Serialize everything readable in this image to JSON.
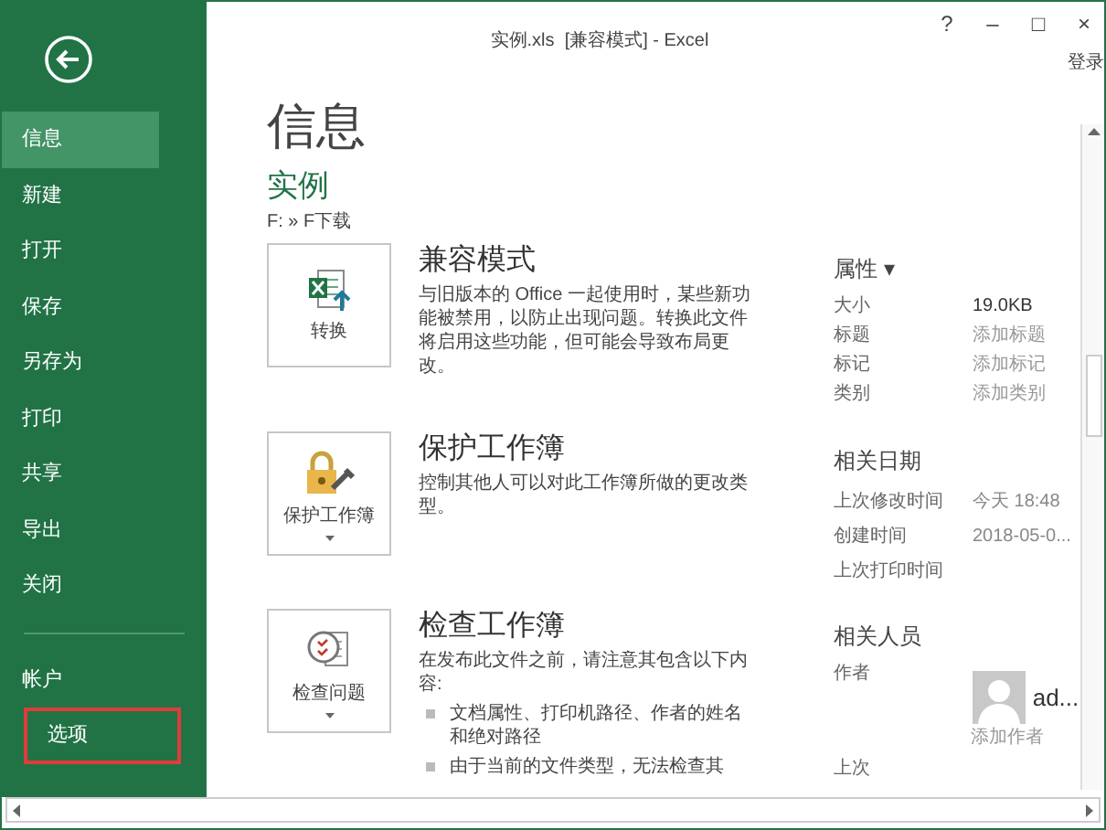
{
  "window": {
    "title": "实例.xls  [兼容模式] - Excel",
    "controls": [
      "?",
      "–",
      "□",
      "×"
    ],
    "sign_in": "登录"
  },
  "sidebar": {
    "items": [
      {
        "label": "信息",
        "selected": true,
        "highlighted": false
      },
      {
        "label": "新建",
        "selected": false,
        "highlighted": false
      },
      {
        "label": "打开",
        "selected": false,
        "highlighted": false
      },
      {
        "label": "保存",
        "selected": false,
        "highlighted": false
      },
      {
        "label": "另存为",
        "selected": false,
        "highlighted": false
      },
      {
        "label": "打印",
        "selected": false,
        "highlighted": false
      },
      {
        "label": "共享",
        "selected": false,
        "highlighted": false
      },
      {
        "label": "导出",
        "selected": false,
        "highlighted": false
      },
      {
        "label": "关闭",
        "selected": false,
        "highlighted": false
      }
    ],
    "bottom_items": [
      {
        "label": "帐户",
        "selected": false,
        "highlighted": false
      },
      {
        "label": "选项",
        "selected": false,
        "highlighted": true
      }
    ]
  },
  "page_title": "信息",
  "file": {
    "name": "实例",
    "path": "F: » F下载"
  },
  "sections": [
    {
      "kind": "convert",
      "button": "转换",
      "has_menu": false,
      "title": "兼容模式",
      "text": "与旧版本的 Office 一起使用时，某些新功能被禁用，以防止出现问题。转换此文件将启用这些功能，但可能会导致布局更改。"
    },
    {
      "kind": "protect",
      "button": "保护工作簿",
      "has_menu": true,
      "title": "保护工作簿",
      "text": "控制其他人可以对此工作簿所做的更改类型。"
    },
    {
      "kind": "inspect",
      "button": "检查问题",
      "has_menu": true,
      "title": "检查工作簿",
      "text": "在发布此文件之前，请注意其包含以下内容:",
      "bullets": [
        "文档属性、打印机路径、作者的姓名和绝对路径",
        "由于当前的文件类型，无法检查其"
      ]
    }
  ],
  "properties": {
    "title": "属性 ▾",
    "rows": [
      {
        "label": "大小",
        "value": "19.0KB",
        "placeholder": false
      },
      {
        "label": "标题",
        "value": "添加标题",
        "placeholder": true
      },
      {
        "label": "标记",
        "value": "添加标记",
        "placeholder": true
      },
      {
        "label": "类别",
        "value": "添加类别",
        "placeholder": true
      }
    ]
  },
  "dates": {
    "title": "相关日期",
    "rows": [
      {
        "label": "上次修改时间",
        "value": "今天 18:48"
      },
      {
        "label": "创建时间",
        "value": "2018-05-0..."
      },
      {
        "label": "上次打印时间"
      }
    ]
  },
  "people": {
    "title": "相关人员",
    "author_label": "作者",
    "author": "ad...",
    "add_author": "添加作者",
    "last_label": "上次"
  }
}
